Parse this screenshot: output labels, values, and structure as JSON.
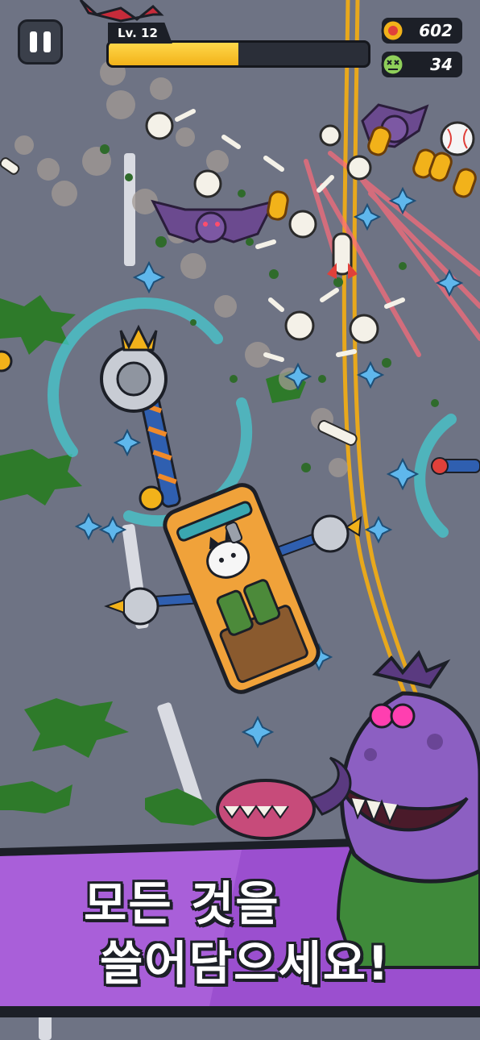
{
  "hud": {
    "level_label": "Lv. 12",
    "xp_progress": 0.5,
    "coins": "602",
    "kills": "34",
    "coin_icon": "coin-icon",
    "kill_icon": "zombie-head-icon",
    "pause_icon": "pause-icon"
  },
  "banner": {
    "line1": "모든 것을",
    "line2": "쓸어담으세요!"
  },
  "colors": {
    "road": "#6e7384",
    "xp_fill": "#f2b21a",
    "banner_purple": "#9b4fcf",
    "truck": "#f0a23a",
    "slime": "#2e7a2a",
    "lane_yellow": "#e8a81c",
    "spark_blue": "#5fb7ec"
  }
}
